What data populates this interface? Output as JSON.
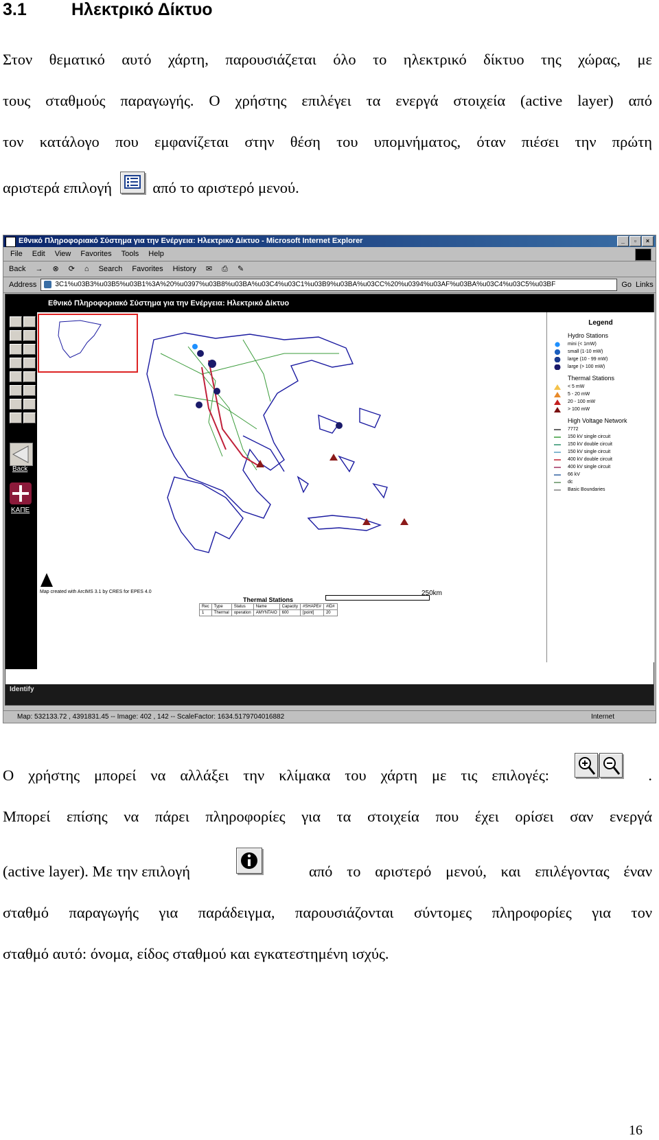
{
  "heading": {
    "number": "3.1",
    "title": "Ηλεκτρικό Δίκτυο"
  },
  "para1": {
    "line1": "Στον θεματικό αυτό χάρτη, παρουσιάζεται όλο το ηλεκτρικό δίκτυο της χώρας, με",
    "line2": "τους σταθμούς παραγωγής. Ο χρήστης επιλέγει τα ενεργά στοιχεία (active layer) από",
    "line3": "τον κατάλογο που εμφανίζεται στην θέση του υπομνήματος, όταν πιέσει την πρώτη",
    "line4_before": "αριστερά επιλογή",
    "line4_after": "από το αριστερό μενού."
  },
  "screenshot": {
    "window_title": "Εθνικό Πληροφοριακό Σύστημα για την Ενέργεια: Ηλεκτρικό Δίκτυο - Microsoft Internet Explorer",
    "menu": [
      "File",
      "Edit",
      "View",
      "Favorites",
      "Tools",
      "Help"
    ],
    "toolbar": [
      "Back",
      "Search",
      "Favorites",
      "History"
    ],
    "address_label": "Address",
    "address_value": "3C1%u03B3%u03B5%u03B1%3A%20%u0397%u03B8%u03BA%u03C4%u03C1%u03B9%u03BA%u03CC%20%u0394%u03AF%u03BA%u03C4%u03C5%u03BF",
    "go_label": "Go",
    "links_label": "Links",
    "app_title": "Εθνικό Πληροφοριακό Σύστημα για την Ενέργεια: Ηλεκτρικό Δίκτυο",
    "back_label": "Back",
    "kape_label": "ΚΑΠΕ",
    "credit": "Map created with ArcIMS 3.1 by CRES for EPES 4.0",
    "scale_label": "250km",
    "station_table": {
      "title": "Thermal Stations",
      "headers": [
        "Rec",
        "Type",
        "Status",
        "Name",
        "Capacity",
        "#SHAPE#",
        "#ID#"
      ],
      "row": [
        "1",
        "Thermal",
        "operation",
        "ΑΜΥΝΤΑΙΟ",
        "600",
        "[point]",
        "20"
      ]
    },
    "identify_label": "Identify",
    "legend": {
      "title": "Legend",
      "hydro_header": "Hydro Stations",
      "hydro": [
        "mini (< 1mW)",
        "small (1-10 mW)",
        "large (10 - 99 mW)",
        "large (> 100 mW)"
      ],
      "thermal_header": "Thermal Stations",
      "thermal": [
        "< 5 mW",
        "5 - 20 mW",
        "20 - 100 mW",
        "> 100 mW"
      ],
      "hv_header": "High Voltage Network",
      "hv": [
        "7772",
        "150 kV single circuit",
        "150 kV double circuit",
        "150 kV single circuit",
        "400 kV double circuit",
        "400 kV single circuit",
        "66 kV",
        "dc"
      ],
      "boundaries": "Basic Boundaries"
    },
    "status_text": "Map: 532133.72 , 4391831.45 -- Image: 402 , 142 -- ScaleFactor: 1634.5179704016882",
    "status_zone": "Internet"
  },
  "para2": {
    "line1": "Ο χρήστης μπορεί να αλλάξει την κλίμακα του χάρτη με τις επιλογές:",
    "line1_end": ".",
    "line2": "Μπορεί επίσης να πάρει πληροφορίες για τα στοιχεία που έχει ορίσει σαν ενεργά",
    "line3_before": "(active layer). Με την επιλογή",
    "line3_after": "από το αριστερό μενού, και επιλέγοντας έναν",
    "line4": "σταθμό παραγωγής για παράδειγμα, παρουσιάζονται σύντομες πληροφορίες για τον",
    "line5": "σταθμό αυτό: όνομα, είδος σταθμού και εγκατεστημένη ισχύς."
  },
  "page_number": "16"
}
